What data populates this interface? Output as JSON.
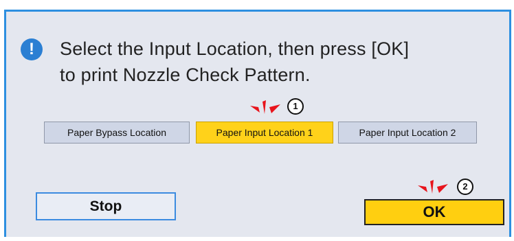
{
  "dialog": {
    "message_line1": "Select the Input Location, then press [OK]",
    "message_line2": "to print Nozzle Check Pattern.",
    "icon": "exclamation-icon"
  },
  "locations": [
    {
      "label": "Paper Bypass Location",
      "selected": false
    },
    {
      "label": "Paper Input Location 1",
      "selected": true
    },
    {
      "label": "Paper Input Location 2",
      "selected": false
    }
  ],
  "steps": {
    "step1": "1",
    "step2": "2"
  },
  "buttons": {
    "stop_label": "Stop",
    "ok_label": "OK"
  },
  "colors": {
    "accent": "#2d8fe0",
    "selected": "#ffd21a",
    "ok": "#ffcf10",
    "marker": "#e8141c"
  }
}
